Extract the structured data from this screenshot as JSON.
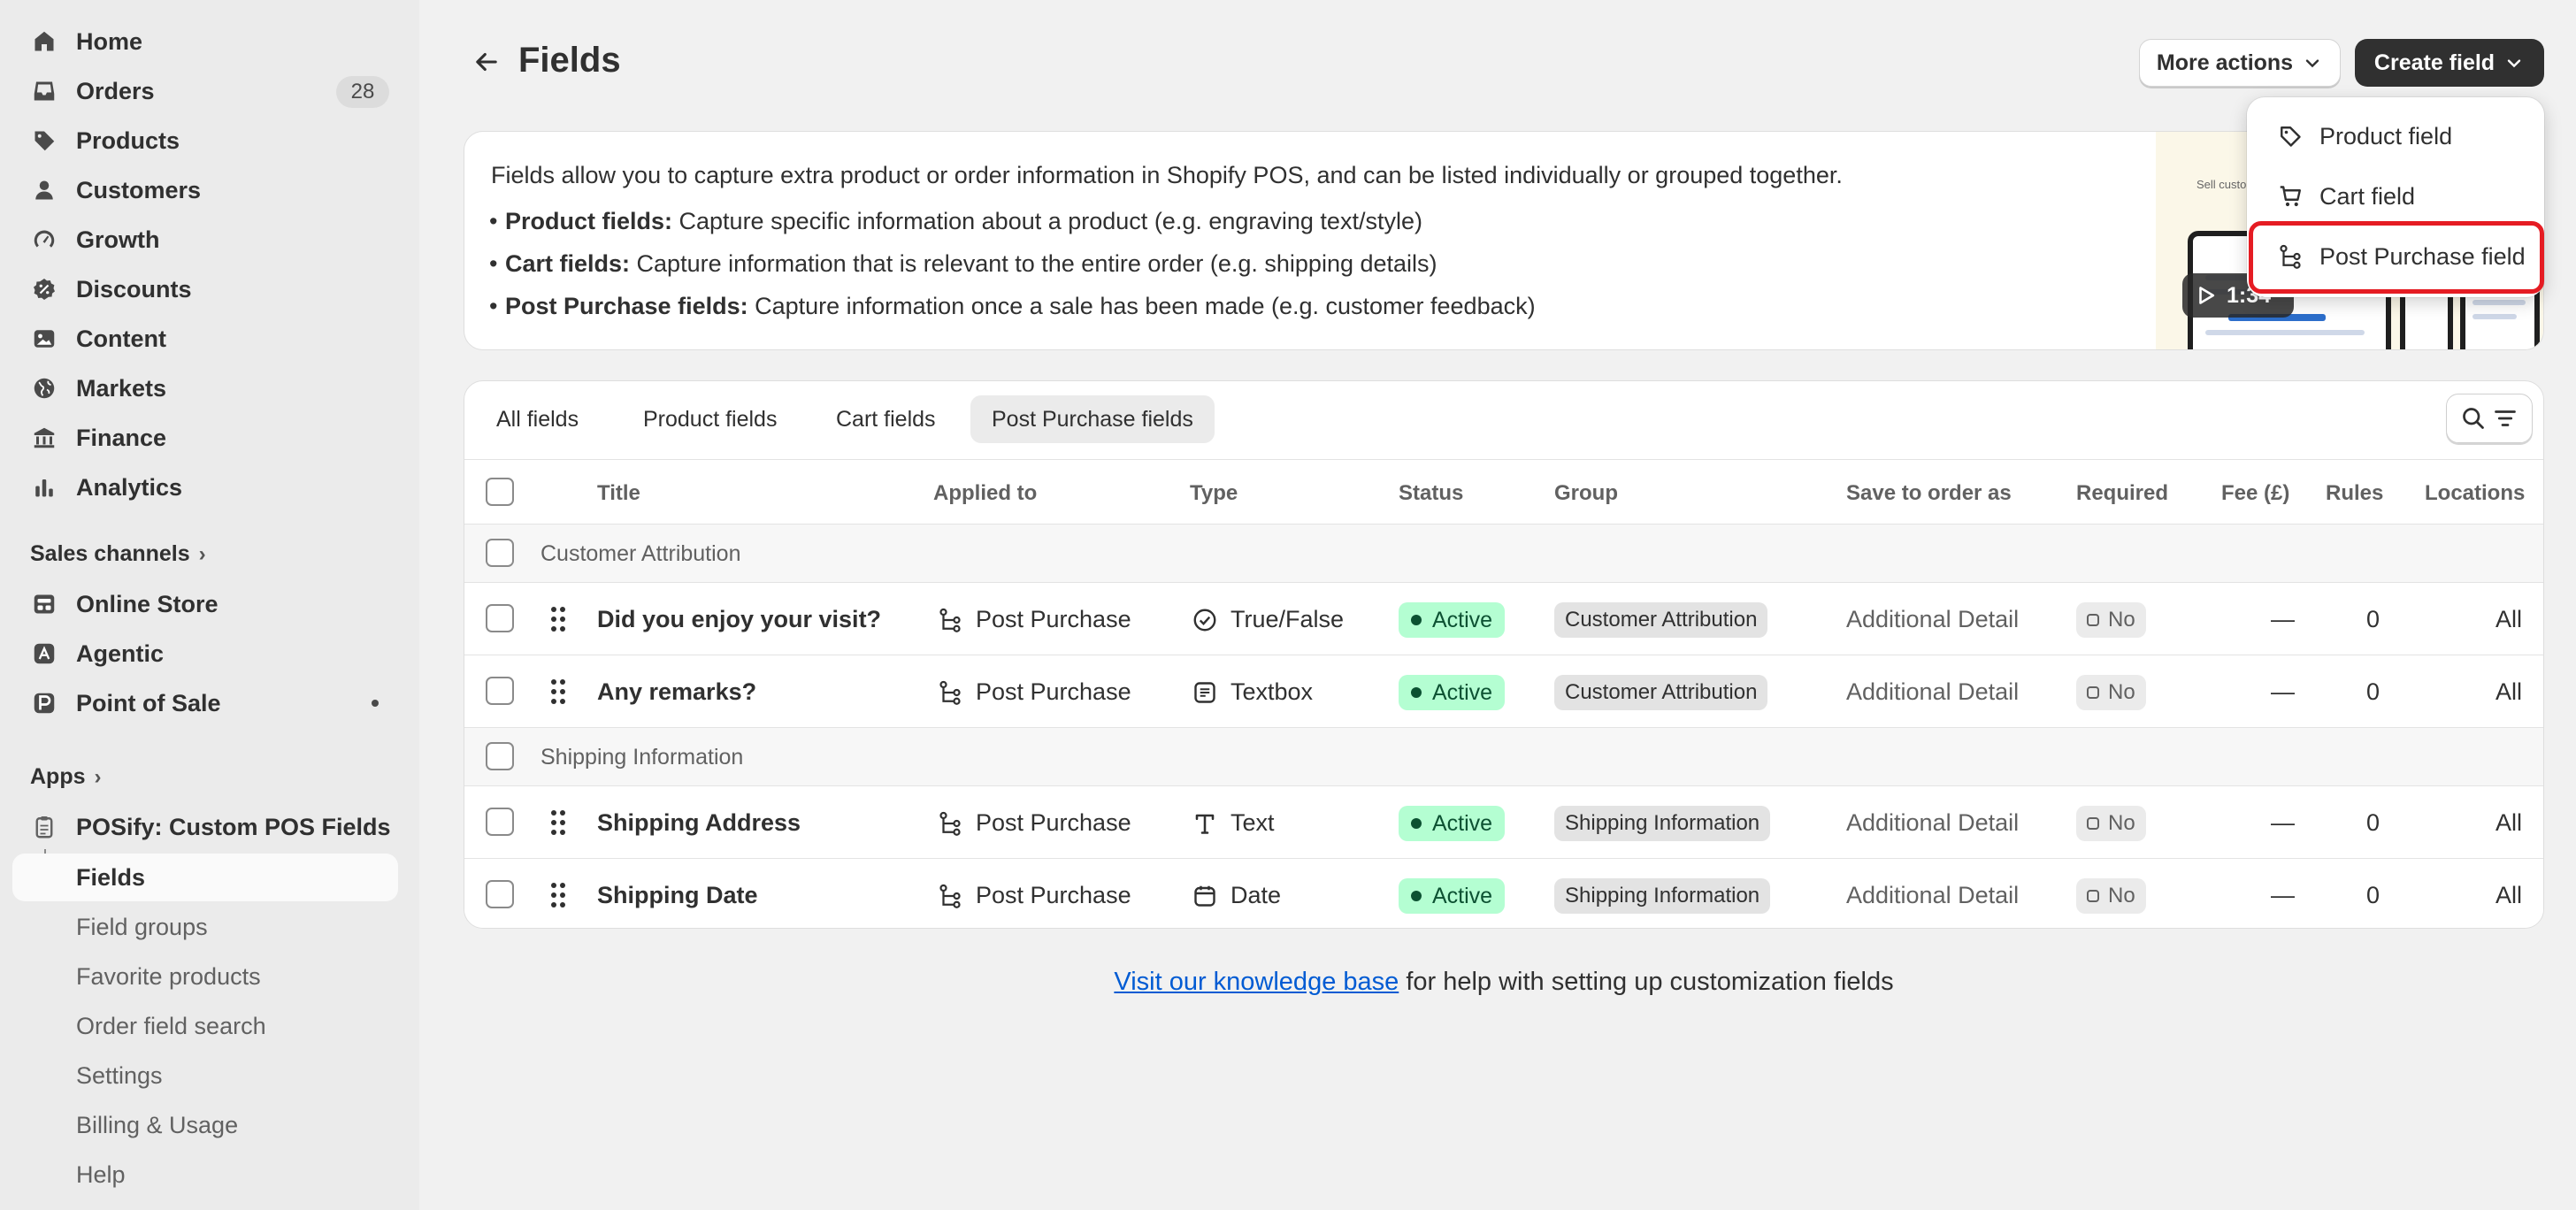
{
  "sidebar": {
    "nav": [
      {
        "label": "Home",
        "icon": "home-icon"
      },
      {
        "label": "Orders",
        "icon": "inbox-icon",
        "badge": "28"
      },
      {
        "label": "Products",
        "icon": "tag-icon"
      },
      {
        "label": "Customers",
        "icon": "person-icon"
      },
      {
        "label": "Growth",
        "icon": "gauge-icon"
      },
      {
        "label": "Discounts",
        "icon": "discount-icon"
      },
      {
        "label": "Content",
        "icon": "image-icon"
      },
      {
        "label": "Markets",
        "icon": "globe-icon"
      },
      {
        "label": "Finance",
        "icon": "bank-icon"
      },
      {
        "label": "Analytics",
        "icon": "bar-chart-icon"
      }
    ],
    "sales_channels_label": "Sales channels",
    "channels": [
      {
        "label": "Online Store",
        "icon": "store-icon"
      },
      {
        "label": "Agentic",
        "icon": "agentic-icon"
      },
      {
        "label": "Point of Sale",
        "icon": "pos-icon"
      }
    ],
    "apps_label": "Apps",
    "app_name": "POSify: Custom POS Fields",
    "app_items": [
      "Fields",
      "Field groups",
      "Favorite products",
      "Order field search",
      "Settings",
      "Billing & Usage",
      "Help"
    ]
  },
  "header": {
    "title": "Fields",
    "more_actions": "More actions",
    "create_field": "Create field"
  },
  "dropdown": {
    "items": [
      {
        "label": "Product field",
        "icon": "tag-outline-icon"
      },
      {
        "label": "Cart field",
        "icon": "cart-icon"
      },
      {
        "label": "Post Purchase field",
        "icon": "flow-icon"
      }
    ]
  },
  "info": {
    "intro": "Fields allow you to capture extra product or order information in Shopify POS, and can be listed individually or grouped together.",
    "bullets": [
      {
        "bold": "Product fields:",
        "text": " Capture specific information about a product (e.g. engraving text/style)"
      },
      {
        "bold": "Cart fields:",
        "text": " Capture information that is relevant to the entire order (e.g. shipping details)"
      },
      {
        "bold": "Post Purchase fields:",
        "text": " Capture information once a sale has been made (e.g. customer feedback)"
      }
    ],
    "video_duration": "1:34",
    "video_caption": "Sell custom"
  },
  "tabs": [
    "All fields",
    "Product fields",
    "Cart fields",
    "Post Purchase fields"
  ],
  "selected_tab": "Post Purchase fields",
  "columns": [
    "Title",
    "Applied to",
    "Type",
    "Status",
    "Group",
    "Save to order as",
    "Required",
    "Fee (£)",
    "Rules",
    "Locations"
  ],
  "groups": [
    {
      "name": "Customer Attribution",
      "rows": [
        {
          "title": "Did you enjoy your visit?",
          "applied_to": "Post Purchase",
          "type": "True/False",
          "type_icon": "check-circle-icon",
          "status": "Active",
          "group": "Customer Attribution",
          "save_as": "Additional Detail",
          "required": "No",
          "fee": "—",
          "rules": "0",
          "locations": "All"
        },
        {
          "title": "Any remarks?",
          "applied_to": "Post Purchase",
          "type": "Textbox",
          "type_icon": "textbox-icon",
          "status": "Active",
          "group": "Customer Attribution",
          "save_as": "Additional Detail",
          "required": "No",
          "fee": "—",
          "rules": "0",
          "locations": "All"
        }
      ]
    },
    {
      "name": "Shipping Information",
      "rows": [
        {
          "title": "Shipping Address",
          "applied_to": "Post Purchase",
          "type": "Text",
          "type_icon": "text-icon",
          "status": "Active",
          "group": "Shipping Information",
          "save_as": "Additional Detail",
          "required": "No",
          "fee": "—",
          "rules": "0",
          "locations": "All"
        },
        {
          "title": "Shipping Date",
          "applied_to": "Post Purchase",
          "type": "Date",
          "type_icon": "calendar-icon",
          "status": "Active",
          "group": "Shipping Information",
          "save_as": "Additional Detail",
          "required": "No",
          "fee": "—",
          "rules": "0",
          "locations": "All"
        }
      ]
    }
  ],
  "footer": {
    "link": "Visit our knowledge base",
    "text": " for help with setting up customization fields"
  },
  "colors": {
    "highlight": "#e51c23",
    "active_badge_bg": "#b4fed2",
    "link": "#005bd3",
    "primary_button": "#303030"
  }
}
